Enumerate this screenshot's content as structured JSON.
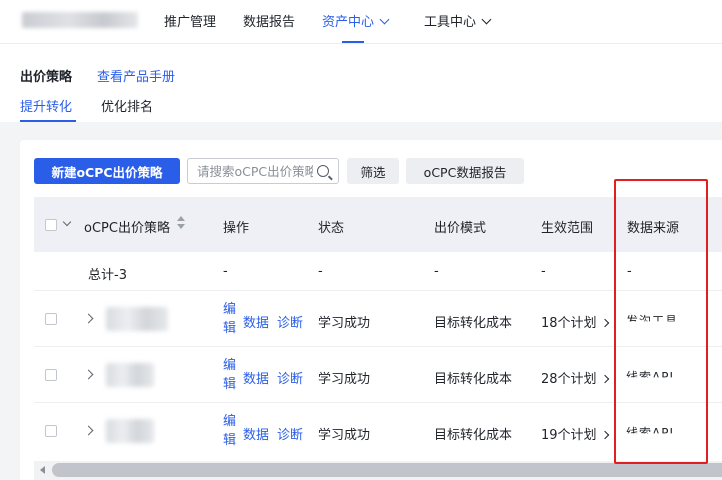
{
  "nav": {
    "items": [
      "推广管理",
      "数据报告",
      "资产中心",
      "工具中心"
    ],
    "active": "资产中心"
  },
  "header": {
    "title": "出价策略",
    "manual_link": "查看产品手册",
    "subtabs": [
      "提升转化",
      "优化排名"
    ],
    "active_subtab": "提升转化"
  },
  "toolbar": {
    "new_button": "新建oCPC出价策略",
    "search_placeholder": "请搜索oCPC出价策略",
    "filter_button": "筛选",
    "report_button": "oCPC数据报告"
  },
  "table": {
    "columns": [
      "oCPC出价策略",
      "操作",
      "状态",
      "出价模式",
      "生效范围",
      "数据来源"
    ],
    "total_row": {
      "label": "总计-3",
      "operation": "-",
      "status": "-",
      "bid_mode": "-",
      "scope": "-",
      "source": "-"
    },
    "operation_links": {
      "edit": "编辑",
      "data": "数据",
      "diagnose": "诊断"
    },
    "rows": [
      {
        "status": "学习成功",
        "bid_mode": "目标转化成本",
        "scope": "18个计划",
        "source": "发沟工具"
      },
      {
        "status": "学习成功",
        "bid_mode": "目标转化成本",
        "scope": "28个计划",
        "source": "线索API"
      },
      {
        "status": "学习成功",
        "bid_mode": "目标转化成本",
        "scope": "19个计划",
        "source": "线索API"
      }
    ]
  },
  "colors": {
    "accent": "#2b5ee8",
    "highlight_box": "#e02020",
    "header_bg": "#eef0f5"
  }
}
